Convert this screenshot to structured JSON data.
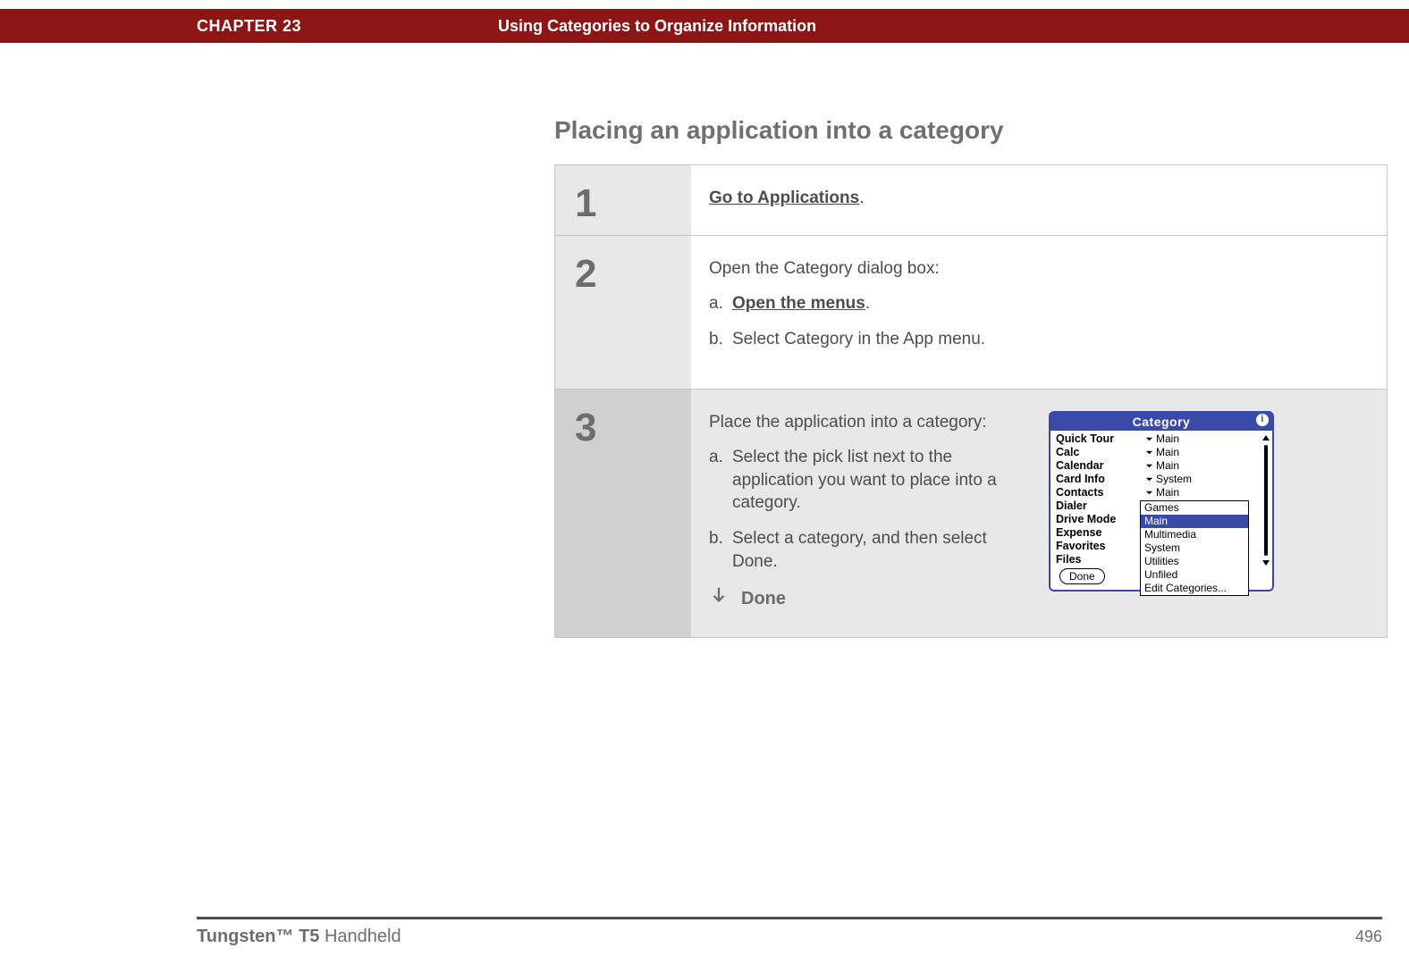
{
  "banner": {
    "chapter": "CHAPTER 23",
    "title": "Using Categories to Organize Information"
  },
  "section_title": "Placing an application into a category",
  "steps": {
    "s1": {
      "num": "1",
      "link": "Go to Applications",
      "after": "."
    },
    "s2": {
      "num": "2",
      "lead": "Open the Category dialog box:",
      "a_label": "a.",
      "a_link": "Open the menus",
      "a_after": ".",
      "b_label": "b.",
      "b_text": "Select Category in the App menu."
    },
    "s3": {
      "num": "3",
      "lead": "Place the application into a category:",
      "a_label": "a.",
      "a_text": "Select the pick list next to the application you want to place into a category.",
      "b_label": "b.",
      "b_text": "Select a category, and then select Done.",
      "done": "Done"
    }
  },
  "palm": {
    "title": "Category",
    "apps": [
      "Quick Tour",
      "Calc",
      "Calendar",
      "Card Info",
      "Contacts",
      "Dialer",
      "Drive Mode",
      "Expense",
      "Favorites",
      "Files"
    ],
    "cats": [
      "Main",
      "Main",
      "Main",
      "System",
      "Main"
    ],
    "popup": [
      "Games",
      "Main",
      "Multimedia",
      "System",
      "Utilities",
      "Unfiled",
      "Edit Categories..."
    ],
    "popup_selected": "Main",
    "done_btn": "Done"
  },
  "footer": {
    "product_bold": "Tungsten™ T5",
    "product_rest": " Handheld",
    "page": "496"
  }
}
